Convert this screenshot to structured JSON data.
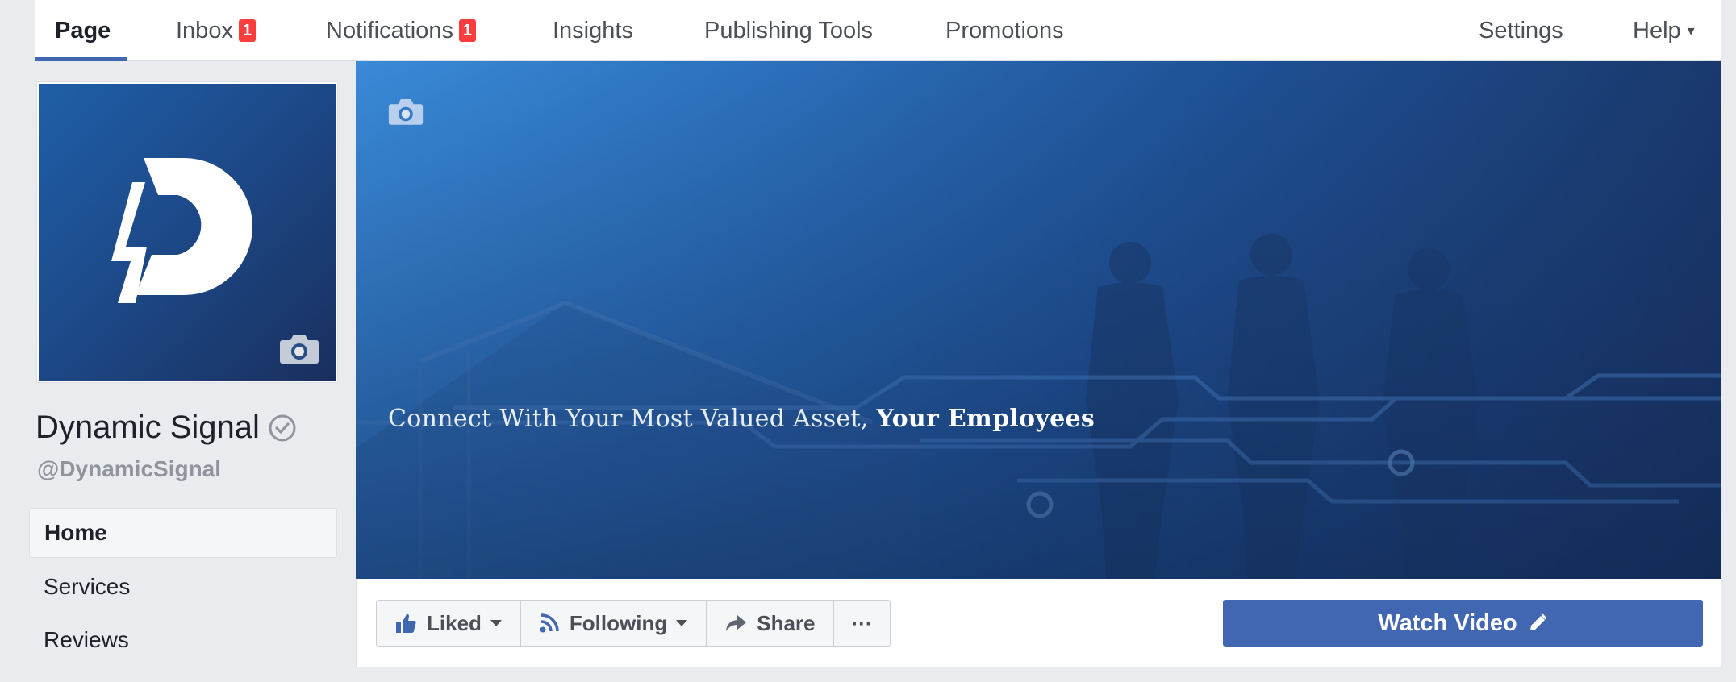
{
  "topnav": {
    "tabs": [
      {
        "label": "Page",
        "active": true
      },
      {
        "label": "Inbox",
        "badge": "1"
      },
      {
        "label": "Notifications",
        "badge": "1"
      },
      {
        "label": "Insights"
      },
      {
        "label": "Publishing Tools"
      },
      {
        "label": "Promotions"
      }
    ],
    "settings_label": "Settings",
    "help_label": "Help"
  },
  "profile": {
    "name": "Dynamic Signal",
    "handle": "@DynamicSignal",
    "logo_icon": "dynamic-signal-logo"
  },
  "sidebar": {
    "items": [
      {
        "label": "Home",
        "active": true
      },
      {
        "label": "Services"
      },
      {
        "label": "Reviews"
      }
    ]
  },
  "cover": {
    "tagline_regular": "Connect With Your Most Valued Asset, ",
    "tagline_bold": "Your Employees"
  },
  "actions": {
    "liked_label": "Liked",
    "following_label": "Following",
    "share_label": "Share",
    "more_label": "···",
    "watch_video_label": "Watch Video"
  },
  "colors": {
    "accent": "#4267b2",
    "badge": "#fa3e3e",
    "cover_light": "#3a8ad8",
    "cover_dark": "#172c58"
  }
}
